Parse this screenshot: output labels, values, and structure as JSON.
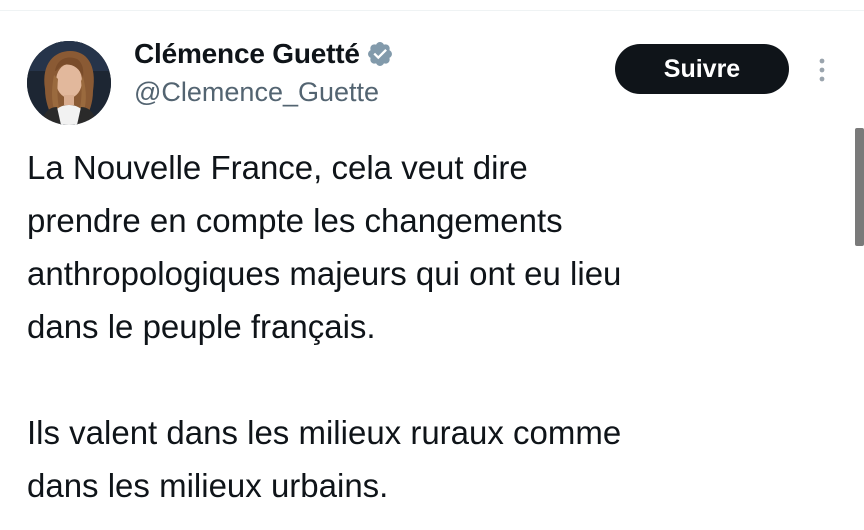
{
  "author": {
    "display_name": "Clémence Guetté",
    "handle": "@Clemence_Guette",
    "verified": true,
    "verified_icon": "verified-badge-icon",
    "verified_color": "#829aab"
  },
  "actions": {
    "follow_label": "Suivre",
    "more_icon": "more-vertical-icon"
  },
  "tweet": {
    "paragraph1": [
      "La Nouvelle France, cela veut dire",
      "prendre en compte les changements",
      "anthropologiques majeurs qui ont eu lieu",
      "dans le peuple français."
    ],
    "paragraph2": [
      "Ils valent dans les milieux ruraux comme",
      "dans les milieux urbains."
    ]
  },
  "colors": {
    "text": "#0f1419",
    "secondary": "#536471",
    "button_bg": "#0f1419",
    "button_text": "#ffffff"
  }
}
